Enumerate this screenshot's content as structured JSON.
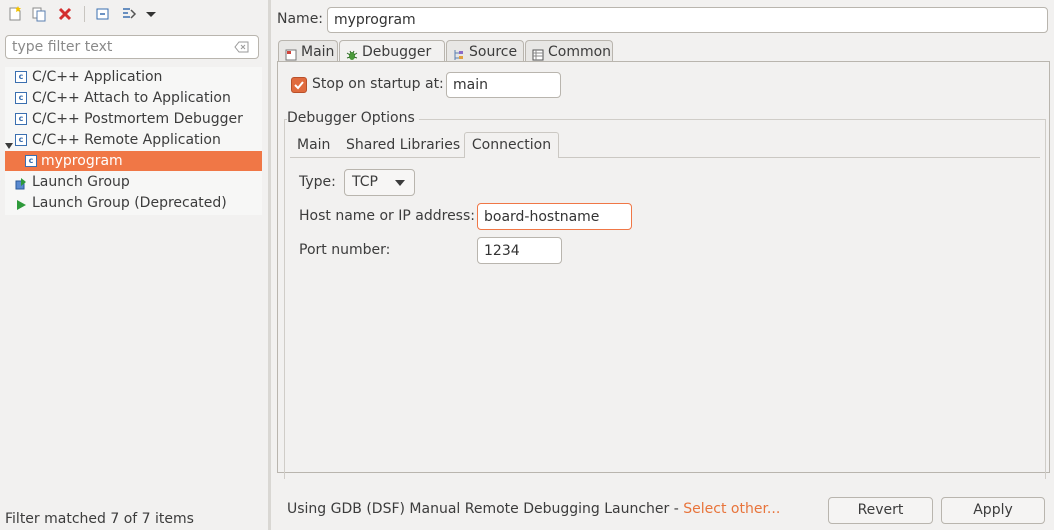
{
  "toolbar": {
    "icons": [
      "new-configuration-icon",
      "duplicate-icon",
      "delete-icon",
      "collapse-all-icon",
      "filter-icon",
      "view-menu-icon"
    ],
    "colors": {
      "delete": "#d32f2f",
      "accent": "#f07746"
    }
  },
  "filter": {
    "placeholder": "type filter text",
    "status": "Filter matched 7 of 7 items"
  },
  "tree": {
    "items": [
      {
        "label": "C/C++ Application",
        "icon": "c-application-icon"
      },
      {
        "label": "C/C++ Attach to Application",
        "icon": "c-application-icon"
      },
      {
        "label": "C/C++ Postmortem Debugger",
        "icon": "c-application-icon"
      },
      {
        "label": "C/C++ Remote Application",
        "icon": "c-application-icon",
        "expanded": true
      },
      {
        "label": "myprogram",
        "icon": "c-application-icon",
        "selected": true
      },
      {
        "label": "Launch Group",
        "icon": "launch-group-icon"
      },
      {
        "label": "Launch Group (Deprecated)",
        "icon": "run-icon"
      }
    ]
  },
  "config": {
    "name_label": "Name:",
    "name": "myprogram",
    "tabs": [
      {
        "label": "Main",
        "icon": "main-tab-icon"
      },
      {
        "label": "Debugger",
        "icon": "debugger-bug-icon",
        "active": true
      },
      {
        "label": "Source",
        "icon": "source-icon"
      },
      {
        "label": "Common",
        "icon": "common-icon"
      }
    ]
  },
  "debugger": {
    "stop_on_startup_label": "Stop on startup at:",
    "stop_on_startup_checked": true,
    "stop_on_startup_value": "main",
    "options_title": "Debugger Options",
    "subtabs": [
      "Main",
      "Shared Libraries",
      "Connection"
    ],
    "active_subtab": "Connection",
    "type_label": "Type:",
    "type_value": "TCP",
    "host_label": "Host name or IP address:",
    "host_value": "board-hostname",
    "port_label": "Port number:",
    "port_value": "1234"
  },
  "footer": {
    "launcher_text": "Using GDB (DSF) Manual Remote Debugging Launcher - ",
    "select_other": "Select other...",
    "revert_label": "Revert",
    "apply_label": "Apply"
  }
}
